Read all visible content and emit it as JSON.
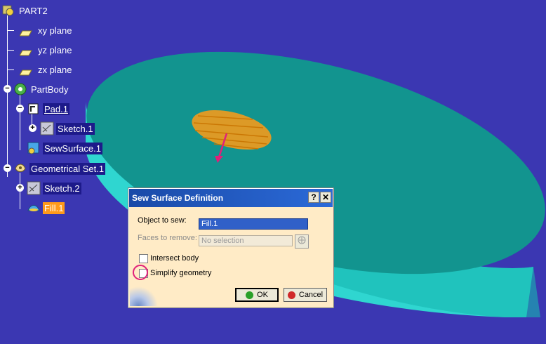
{
  "tree": {
    "root": "PART2",
    "planes": [
      "xy plane",
      "yz plane",
      "zx plane"
    ],
    "part_body": "PartBody",
    "pad": "Pad.1",
    "sketch1": "Sketch.1",
    "sew_surface": "SewSurface.1",
    "geo_set": "Geometrical Set.1",
    "sketch2": "Sketch.2",
    "fill": "Fill.1"
  },
  "dialog": {
    "title": "Sew Surface Definition",
    "help_label": "?",
    "close_label": "✕",
    "object_label": "Object to sew:",
    "object_value": "Fill.1",
    "faces_label": "Faces to remove:",
    "faces_value": "No selection",
    "intersect_label": "Intersect body",
    "simplify_label": "Simplify geometry",
    "ok_label": "OK",
    "cancel_label": "Cancel"
  },
  "colors": {
    "background": "#3b37b2",
    "solid_top": "#12948f",
    "solid_side": "#2fd6d0",
    "fill_surface": "#f39a1c",
    "highlight": "#ff9a1a",
    "annotation": "#e0207a"
  }
}
